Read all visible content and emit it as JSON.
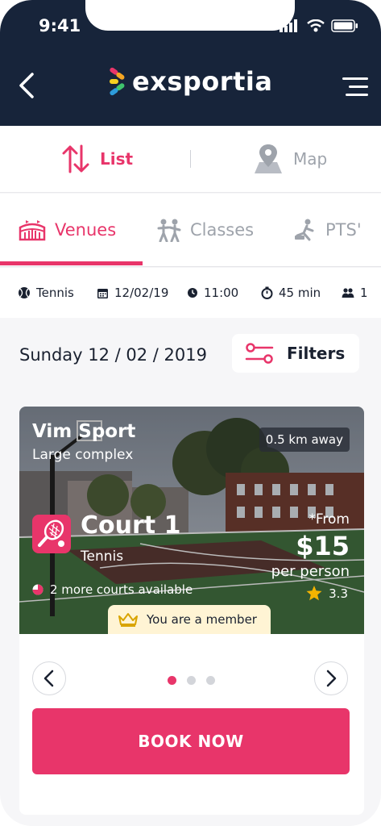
{
  "status": {
    "time": "9:41"
  },
  "header": {
    "brand": "exsportia"
  },
  "view_toggle": {
    "list_label": "List",
    "map_label": "Map",
    "active": "list"
  },
  "tabs": [
    {
      "label": "Venues",
      "active": true
    },
    {
      "label": "Classes",
      "active": false
    },
    {
      "label": "PTS'",
      "active": false
    }
  ],
  "info": {
    "sport": "Tennis",
    "date": "12/02/19",
    "time": "11:00",
    "duration": "45 min",
    "people": "1"
  },
  "date_heading": "Sunday 12 / 02 / 2019",
  "filters_label": "Filters",
  "card": {
    "venue_name": "Vim Sport",
    "venue_type": "Large complex",
    "distance": "0.5 km away",
    "court_name": "Court 1",
    "court_sport": "Tennis",
    "more_courts": "2 more courts available",
    "price_from": "*From",
    "price": "$15",
    "per_person": "per person",
    "rating": "3.3",
    "member_badge": "You are a member",
    "pagination": {
      "current": 1,
      "total": 3
    }
  },
  "book_button": "BOOK NOW",
  "colors": {
    "accent": "#e8356a",
    "header_bg": "#17243a",
    "text_dark": "#1a2130",
    "inactive": "#9ea3ab",
    "member_bg": "#fff4d4",
    "star": "#f5b400"
  },
  "icons": [
    "back-arrow-icon",
    "menu-icon",
    "sort-arrows-icon",
    "map-pin-icon",
    "stadium-icon",
    "classes-icon",
    "pt-icon",
    "tennis-ball-icon",
    "calendar-icon",
    "clock-icon",
    "timer-icon",
    "people-icon",
    "filters-sliders-icon",
    "tennis-racket-icon",
    "pie-indicator-icon",
    "star-icon",
    "crown-icon",
    "chevron-left-icon",
    "chevron-right-icon"
  ]
}
